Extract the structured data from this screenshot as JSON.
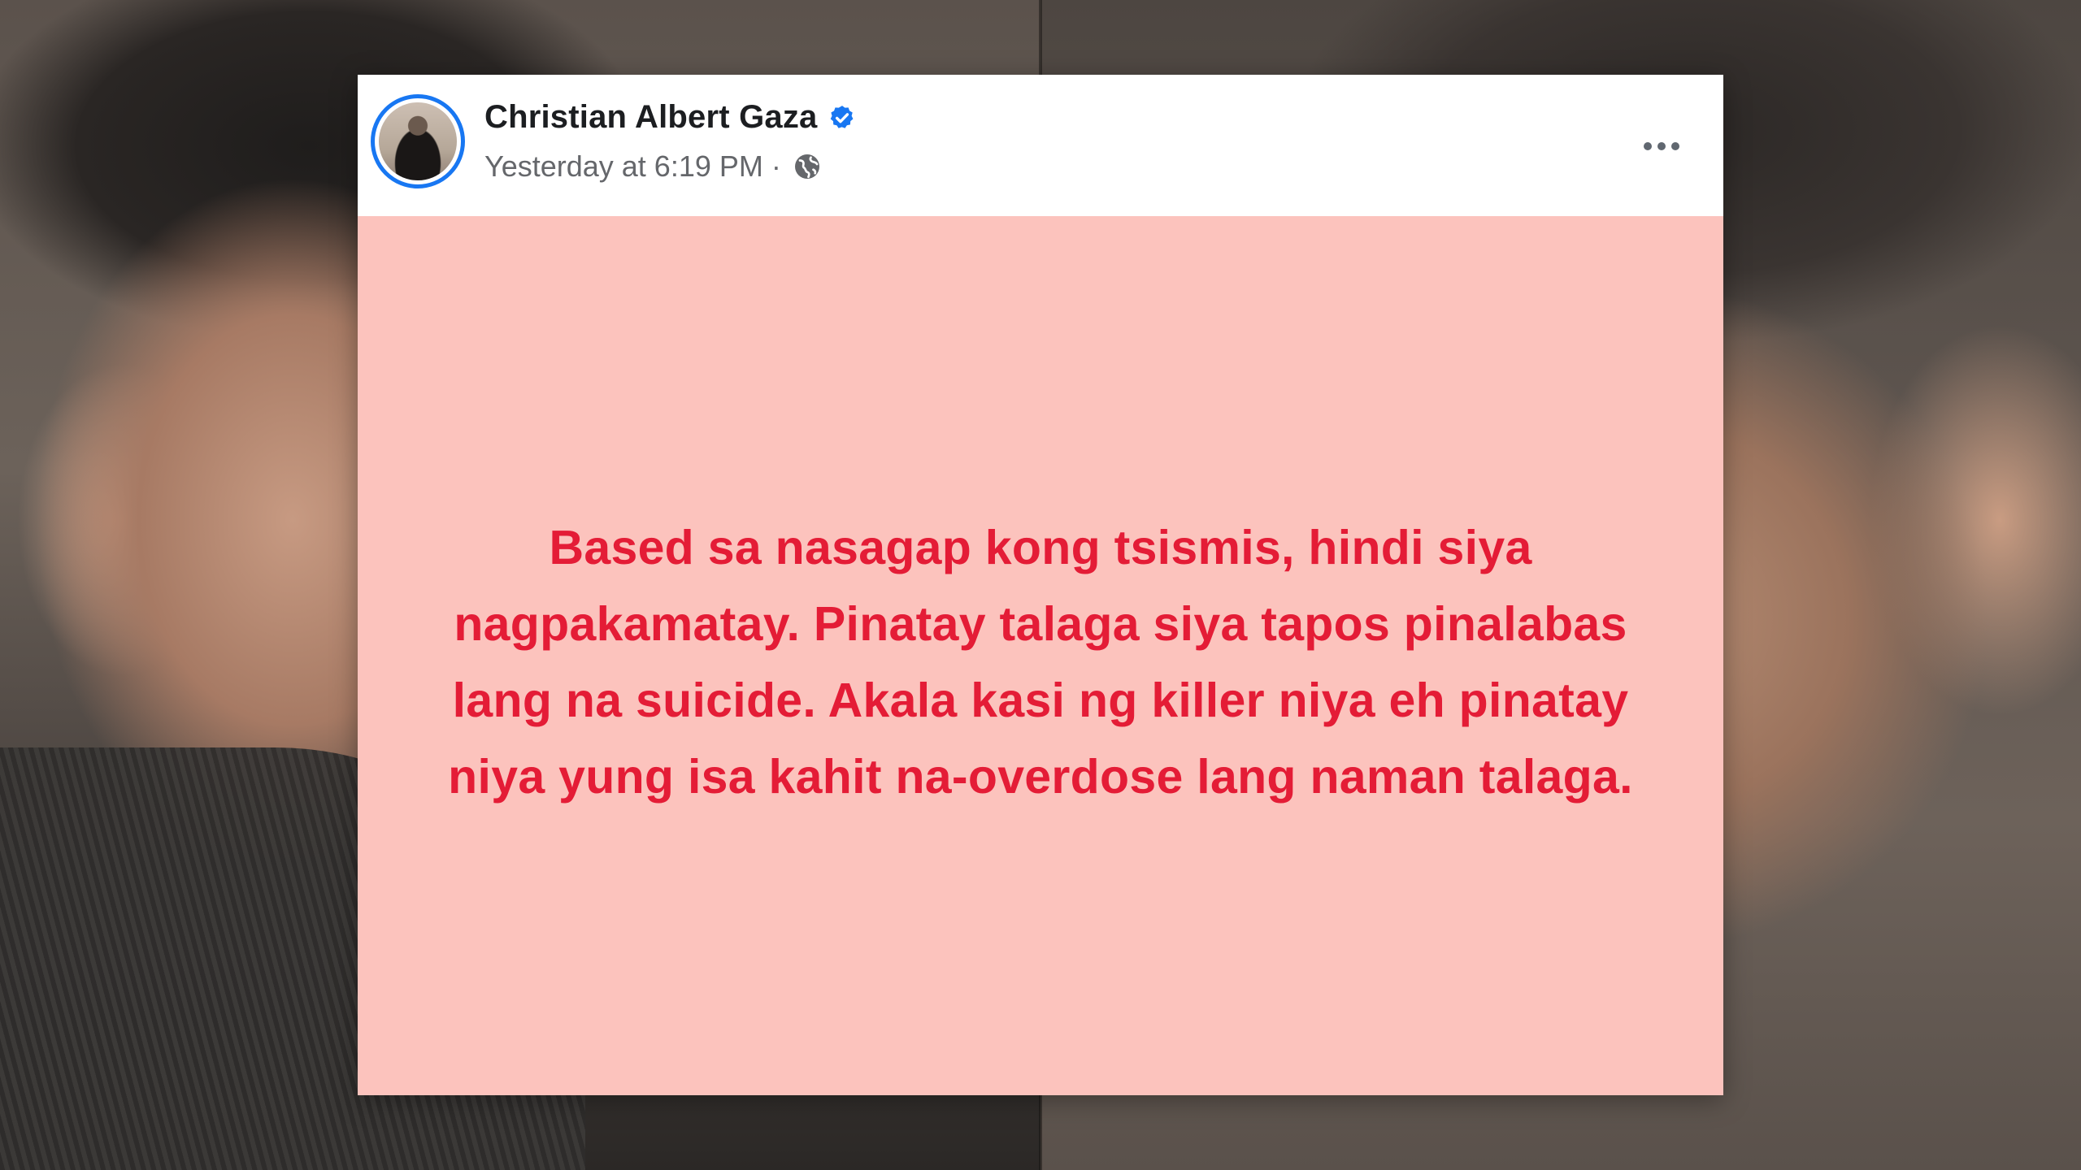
{
  "post": {
    "author_name": "Christian Albert Gaza",
    "verified": true,
    "timestamp": "Yesterday at 6:19 PM",
    "separator": "·",
    "privacy_icon": "globe-icon",
    "more_icon": "more-options-icon",
    "body_text": "Based sa nasagap kong tsismis, hindi siya nagpakamatay. Pinatay talaga siya tapos pinalabas lang na suicide. Akala kasi ng killer niya eh pinatay niya yung isa kahit na-overdose lang naman talaga.",
    "body_background_color": "#fcc3bd",
    "body_text_color": "#e41c36"
  },
  "colors": {
    "verified_badge": "#1877f2",
    "avatar_ring": "#1877f2",
    "name_text": "#1c1e21",
    "meta_text": "#65676b"
  }
}
